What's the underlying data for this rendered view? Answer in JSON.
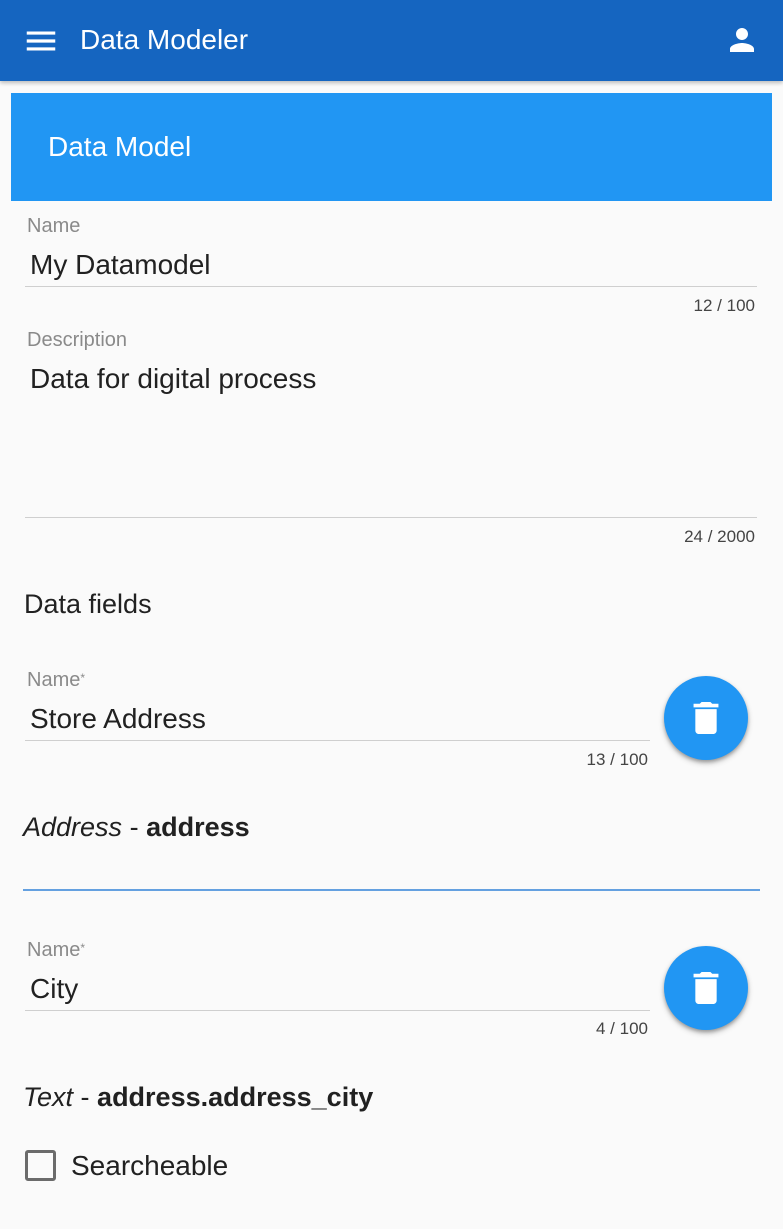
{
  "app": {
    "title": "Data Modeler",
    "menu_icon": "menu-icon",
    "account_icon": "account-icon",
    "bar_color": "#1565c0"
  },
  "card": {
    "title": "Data Model",
    "header_color": "#2196f3"
  },
  "model": {
    "name_label": "Name",
    "name_value": "My Datamodel",
    "name_counter": "12 / 100",
    "description_label": "Description",
    "description_value": "Data for digital process",
    "description_counter": "24 / 2000"
  },
  "data_fields": {
    "title": "Data fields",
    "items": [
      {
        "name_label": "Name",
        "required_mark": "*",
        "name_value": "Store Address",
        "counter": "13 / 100",
        "type_name": "Address",
        "separator": " - ",
        "type_path": "address",
        "delete_icon": "trash-icon"
      },
      {
        "name_label": "Name",
        "required_mark": "*",
        "name_value": "City",
        "counter": "4 / 100",
        "type_name": "Text",
        "separator": " - ",
        "type_path": "address.address_city",
        "delete_icon": "trash-icon",
        "searchable_label": "Searcheable",
        "searchable_checked": false
      }
    ]
  }
}
